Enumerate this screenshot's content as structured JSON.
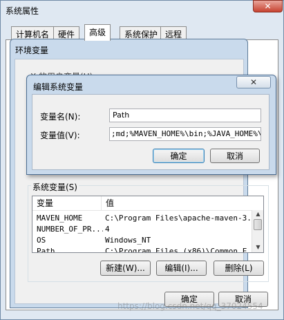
{
  "system_properties": {
    "title": "系统属性",
    "close_glyph": "✕",
    "tabs": [
      {
        "label": "计算机名"
      },
      {
        "label": "硬件"
      },
      {
        "label": "高级"
      },
      {
        "label": "系统保护"
      },
      {
        "label": "远程"
      }
    ],
    "active_tab": "高级"
  },
  "env_vars": {
    "title": "环境变量",
    "user_vars_label": "X    的用户变量(U)",
    "system_vars_label": "系统变量(S)",
    "table": {
      "headers": [
        "变量",
        "值"
      ],
      "rows": [
        {
          "name": "MAVEN_HOME",
          "value": "C:\\Program Files\\apache-maven-3..."
        },
        {
          "name": "NUMBER_OF_PR...",
          "value": "4"
        },
        {
          "name": "OS",
          "value": "Windows_NT"
        },
        {
          "name": "Path",
          "value": "C:\\Program Files (x86)\\Common F..."
        }
      ]
    },
    "buttons": {
      "new": "新建(W)...",
      "edit": "编辑(I)...",
      "delete": "删除(L)"
    },
    "ok": "确定",
    "cancel": "取消"
  },
  "edit_dialog": {
    "title": "编辑系统变量",
    "close_glyph": "✕",
    "var_name_label": "变量名(N):",
    "var_name_value": "Path",
    "var_value_label": "变量值(V):",
    "var_value_value": ";md;%MAVEN_HOME%\\bin;%JAVA_HOME%\\bin",
    "ok": "确定",
    "cancel": "取消"
  },
  "scrollbar": {
    "up_glyph": "▲",
    "down_glyph": "▼"
  },
  "watermark": "https://blog.csdn.net/qq_37024554"
}
